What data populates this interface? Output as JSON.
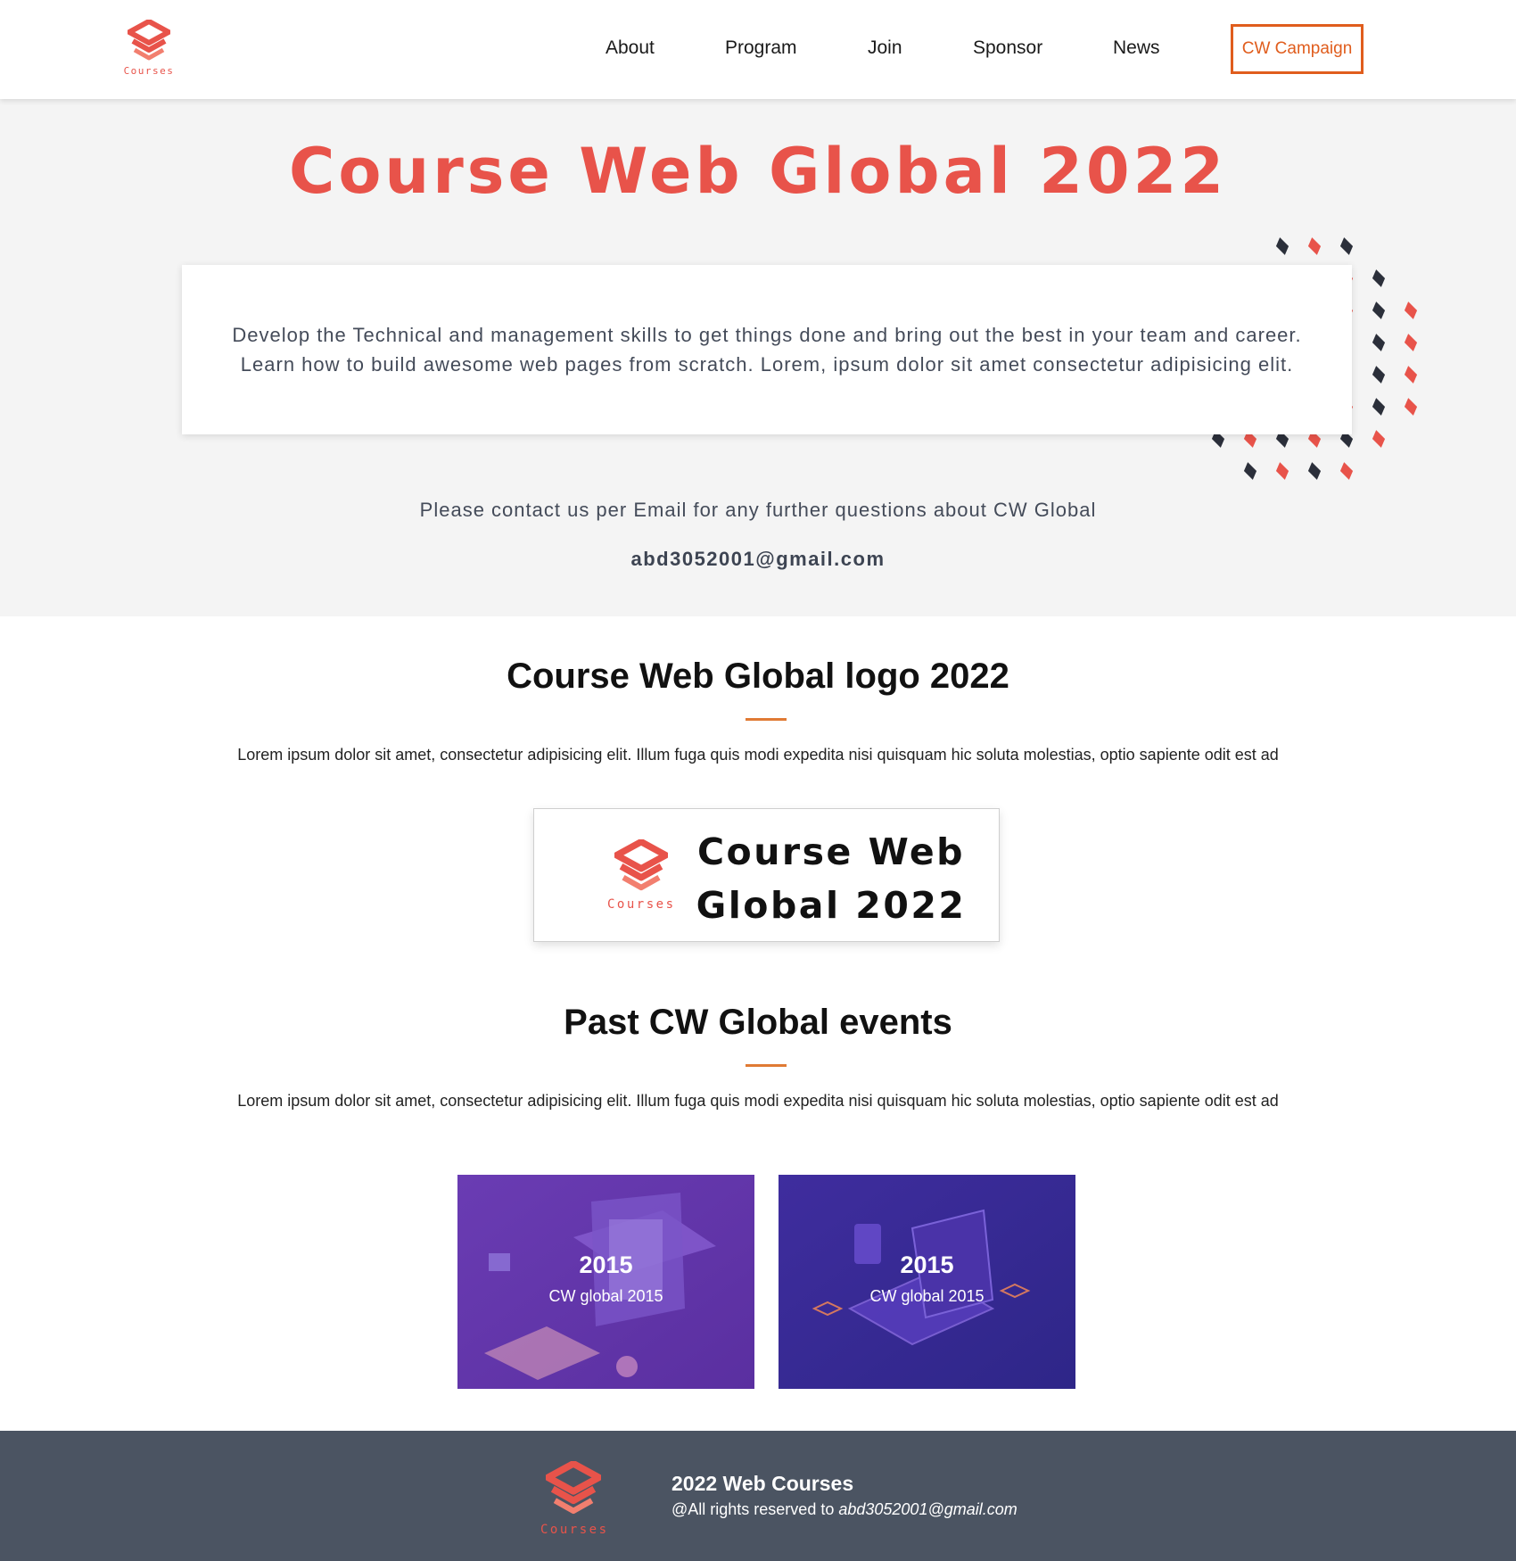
{
  "brand": {
    "logo_word": "Courses",
    "accent": "#e8534a",
    "cta_color": "#e05d1d",
    "footer_bg": "#4b5462"
  },
  "nav": {
    "items": [
      {
        "label": "About"
      },
      {
        "label": "Program"
      },
      {
        "label": "Join"
      },
      {
        "label": "Sponsor"
      },
      {
        "label": "News"
      }
    ],
    "cta": "CW Campaign"
  },
  "hero": {
    "title": "Course Web Global 2022",
    "intro": "Develop the Technical and management skills to get things done and bring out the best in your team and career. Learn how to build awesome web pages from scratch. Lorem, ipsum dolor sit amet consectetur adipisicing elit.",
    "contact": "Please contact us per Email for any further questions about CW Global",
    "email": "abd3052001@gmail.com"
  },
  "logo_section": {
    "title": "Course Web Global logo 2022",
    "body": "Lorem ipsum dolor sit amet, consectetur adipisicing elit. Illum fuga quis modi expedita nisi quisquam hic soluta molestias, optio sapiente odit est ad",
    "card_title": "Course Web Global 2022"
  },
  "events_section": {
    "title": "Past CW Global events",
    "body": "Lorem ipsum dolor sit amet, consectetur adipisicing elit. Illum fuga quis modi expedita nisi quisquam hic soluta molestias, optio sapiente odit est ad",
    "events": [
      {
        "year": "2015",
        "label": "CW global 2015"
      },
      {
        "year": "2015",
        "label": "CW global 2015"
      }
    ]
  },
  "footer": {
    "title": "2022 Web Courses",
    "rights_prefix": "@All rights reserved to ",
    "rights_email": "abd3052001@gmail.com"
  }
}
